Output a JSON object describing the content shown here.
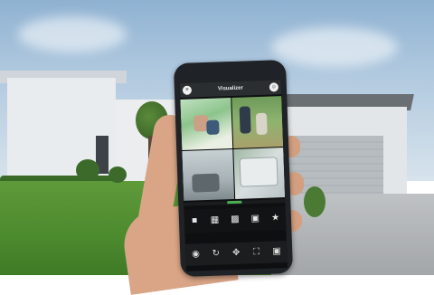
{
  "app": {
    "title": "Visualizer",
    "menu_icon": "menu-icon",
    "profile_icon": "profile-icon"
  },
  "camera_grid": [
    {
      "name": "camera-1",
      "icon": "camera-feed"
    },
    {
      "name": "camera-2",
      "icon": "camera-feed"
    },
    {
      "name": "camera-3",
      "icon": "camera-feed"
    },
    {
      "name": "camera-4",
      "icon": "camera-feed"
    }
  ],
  "layout_buttons": [
    {
      "name": "layout-single",
      "glyph": "■"
    },
    {
      "name": "layout-quad",
      "glyph": "▦"
    },
    {
      "name": "layout-nine",
      "glyph": "▩"
    },
    {
      "name": "layout-sixteen",
      "glyph": "▣"
    },
    {
      "name": "favorites",
      "glyph": "★"
    }
  ],
  "controls": [
    {
      "name": "snapshot",
      "glyph": "◉"
    },
    {
      "name": "playback",
      "glyph": "↻"
    },
    {
      "name": "ptz",
      "glyph": "✥"
    },
    {
      "name": "fullscreen",
      "glyph": "⛶"
    },
    {
      "name": "record",
      "glyph": "▣"
    }
  ],
  "colors": {
    "accent": "#4caf50",
    "header_bg": "#2b2e31"
  }
}
